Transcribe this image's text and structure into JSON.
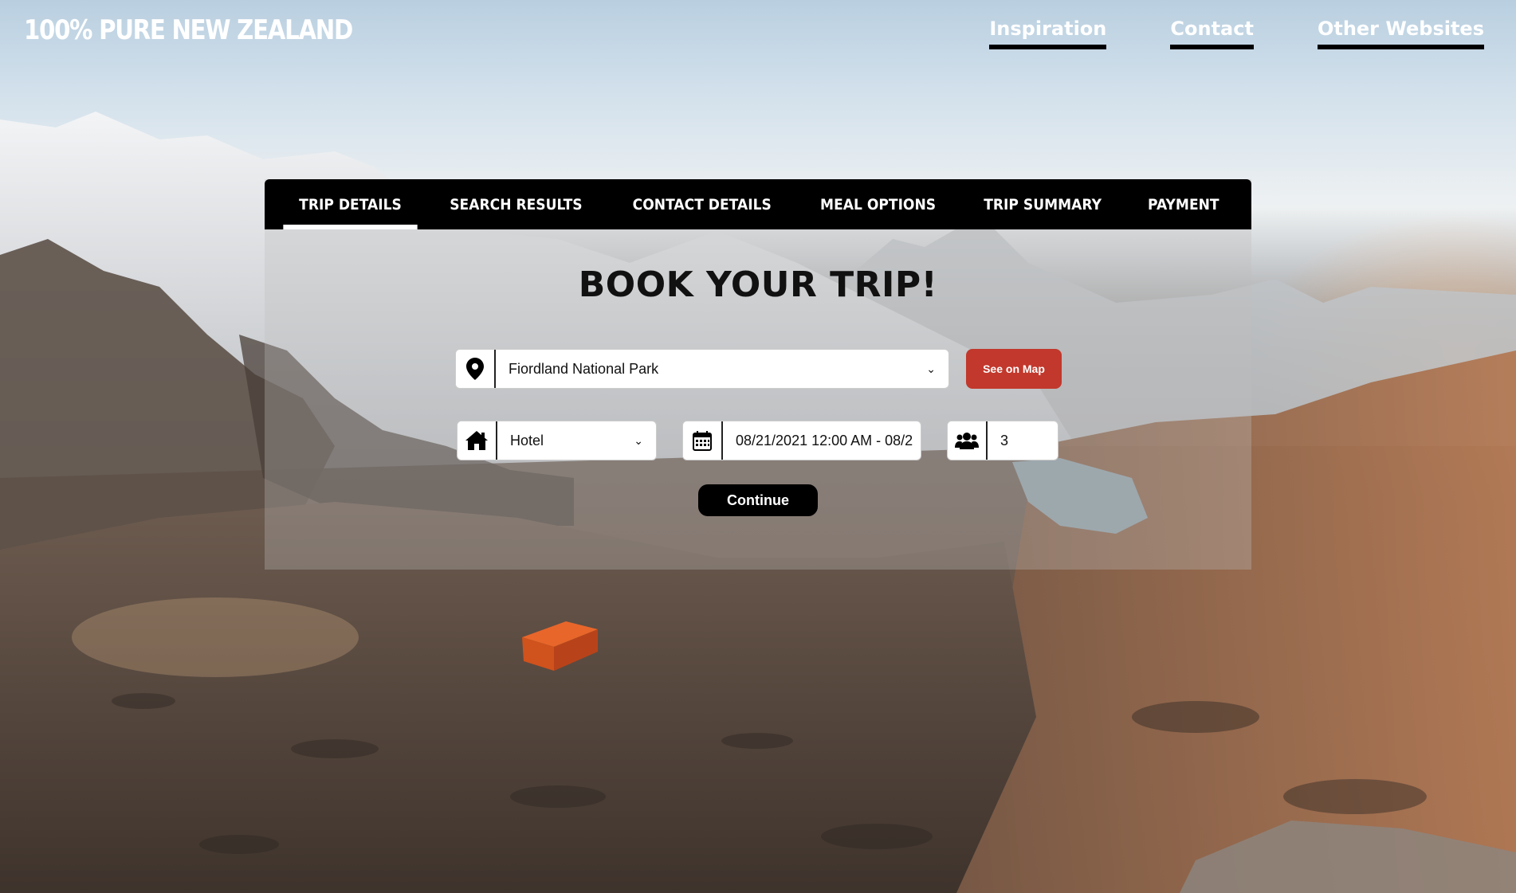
{
  "brand": "100% PURE NEW ZEALAND",
  "nav": [
    "Inspiration",
    "Contact",
    "Other Websites"
  ],
  "tabs": [
    "TRIP DETAILS",
    "SEARCH RESULTS",
    "CONTACT DETAILS",
    "MEAL OPTIONS",
    "TRIP SUMMARY",
    "PAYMENT"
  ],
  "active_tab": "TRIP DETAILS",
  "heading": "BOOK YOUR TRIP!",
  "form": {
    "destination": "Fiordland National Park",
    "see_on_map": "See on Map",
    "accommodation": "Hotel",
    "dates": "08/21/2021 12:00 AM - 08/2",
    "guests": "3",
    "continue": "Continue"
  },
  "icons": {
    "destination": "map-pin-icon",
    "accommodation": "home-icon",
    "dates": "calendar-icon",
    "guests": "users-icon"
  },
  "colors": {
    "accent_red": "#c2382c",
    "tab_bar": "#000000",
    "text_white": "#ffffff"
  }
}
